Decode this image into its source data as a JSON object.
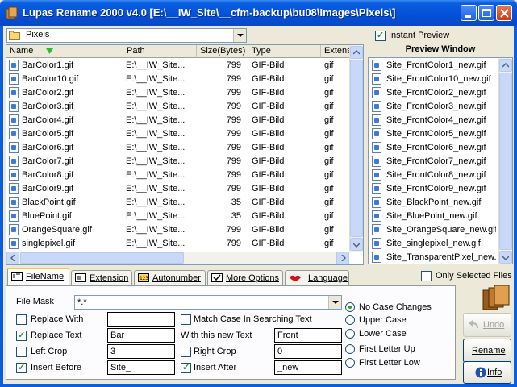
{
  "window": {
    "title": "Lupas Rename 2000 v4.0  [E:\\__IW_Site\\__cfm-backup\\bu08\\Images\\Pixels\\]"
  },
  "folder": {
    "current": "Pixels"
  },
  "columns": {
    "name": "Name",
    "path": "Path",
    "size": "Size(Bytes)",
    "type": "Type",
    "ext": "Extens"
  },
  "files": [
    {
      "name": "BarColor1.gif",
      "path": "E:\\__IW_Site...",
      "size": "799",
      "type": "GIF-Bild",
      "ext": "gif"
    },
    {
      "name": "BarColor10.gif",
      "path": "E:\\__IW_Site...",
      "size": "799",
      "type": "GIF-Bild",
      "ext": "gif"
    },
    {
      "name": "BarColor2.gif",
      "path": "E:\\__IW_Site...",
      "size": "799",
      "type": "GIF-Bild",
      "ext": "gif"
    },
    {
      "name": "BarColor3.gif",
      "path": "E:\\__IW_Site...",
      "size": "799",
      "type": "GIF-Bild",
      "ext": "gif"
    },
    {
      "name": "BarColor4.gif",
      "path": "E:\\__IW_Site...",
      "size": "799",
      "type": "GIF-Bild",
      "ext": "gif"
    },
    {
      "name": "BarColor5.gif",
      "path": "E:\\__IW_Site...",
      "size": "799",
      "type": "GIF-Bild",
      "ext": "gif"
    },
    {
      "name": "BarColor6.gif",
      "path": "E:\\__IW_Site...",
      "size": "799",
      "type": "GIF-Bild",
      "ext": "gif"
    },
    {
      "name": "BarColor7.gif",
      "path": "E:\\__IW_Site...",
      "size": "799",
      "type": "GIF-Bild",
      "ext": "gif"
    },
    {
      "name": "BarColor8.gif",
      "path": "E:\\__IW_Site...",
      "size": "799",
      "type": "GIF-Bild",
      "ext": "gif"
    },
    {
      "name": "BarColor9.gif",
      "path": "E:\\__IW_Site...",
      "size": "799",
      "type": "GIF-Bild",
      "ext": "gif"
    },
    {
      "name": "BlackPoint.gif",
      "path": "E:\\__IW_Site...",
      "size": "35",
      "type": "GIF-Bild",
      "ext": "gif"
    },
    {
      "name": "BluePoint.gif",
      "path": "E:\\__IW_Site...",
      "size": "35",
      "type": "GIF-Bild",
      "ext": "gif"
    },
    {
      "name": "OrangeSquare.gif",
      "path": "E:\\__IW_Site...",
      "size": "799",
      "type": "GIF-Bild",
      "ext": "gif"
    },
    {
      "name": "singlepixel.gif",
      "path": "E:\\__IW_Site...",
      "size": "799",
      "type": "GIF-Bild",
      "ext": "gif"
    }
  ],
  "preview": {
    "instant_label": "Instant Preview",
    "title": "Preview Window",
    "items": [
      "Site_FrontColor1_new.gif",
      "Site_FrontColor10_new.gif",
      "Site_FrontColor2_new.gif",
      "Site_FrontColor3_new.gif",
      "Site_FrontColor4_new.gif",
      "Site_FrontColor5_new.gif",
      "Site_FrontColor6_new.gif",
      "Site_FrontColor7_new.gif",
      "Site_FrontColor8_new.gif",
      "Site_FrontColor9_new.gif",
      "Site_BlackPoint_new.gif",
      "Site_BluePoint_new.gif",
      "Site_OrangeSquare_new.gif",
      "Site_singlepixel_new.gif",
      "Site_TransparentPixel_new.gif"
    ]
  },
  "tabs": [
    {
      "label": "FileName",
      "icon": "filename-icon"
    },
    {
      "label": "Extension",
      "icon": "extension-icon"
    },
    {
      "label": "Autonumber",
      "icon": "autonumber-icon"
    },
    {
      "label": "More Options",
      "icon": "more-options-icon"
    },
    {
      "label": "Language",
      "icon": "lips-icon"
    }
  ],
  "only_selected": "Only Selected Files",
  "options": {
    "file_mask_label": "File Mask",
    "file_mask_value": "*.*",
    "replace_with": "Replace With",
    "replace_with_value": "",
    "replace_text": "Replace Text",
    "replace_text_value": "Bar",
    "left_crop": "Left Crop",
    "left_crop_value": "3",
    "insert_before": "Insert Before",
    "insert_before_value": "Site_",
    "match_case": "Match Case In Searching Text",
    "match_case_value": "",
    "with_new_text": "With this new Text",
    "with_new_text_value": "Front",
    "right_crop": "Right Crop",
    "right_crop_value": "0",
    "insert_after": "Insert After",
    "insert_after_value": "_new"
  },
  "case_options": [
    "No Case Changes",
    "Upper Case",
    "Lower Case",
    "First Letter Up",
    "First Letter Low"
  ],
  "buttons": {
    "undo": "Undo",
    "rename": "Rename",
    "info": "Info"
  }
}
